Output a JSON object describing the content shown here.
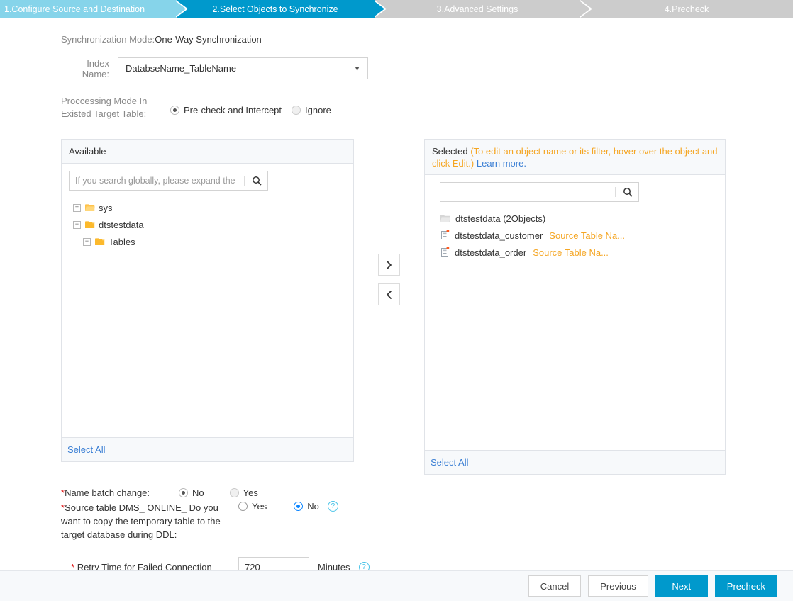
{
  "steps": [
    {
      "label": "1.Configure Source and Destination",
      "state": "done"
    },
    {
      "label": "2.Select Objects to Synchronize",
      "state": "active"
    },
    {
      "label": "3.Advanced Settings",
      "state": "todo"
    },
    {
      "label": "4.Precheck",
      "state": "todo"
    }
  ],
  "form": {
    "sync_mode_label": "Synchronization Mode:",
    "sync_mode_value": "One-Way Synchronization",
    "index_name_label": "Index Name:",
    "index_name_value": "DatabseName_TableName",
    "processing_mode_label_l1": "Proccessing Mode In",
    "processing_mode_label_l2": "Existed Target Table:",
    "processing_mode_opt1": "Pre-check and Intercept",
    "processing_mode_opt2": "Ignore"
  },
  "available": {
    "title": "Available",
    "search_placeholder": "If you search globally, please expand the n",
    "search_value": "",
    "select_all": "Select All",
    "tree": [
      {
        "label": "sys",
        "level": 1,
        "toggle": "+",
        "folder": "folder-closed-icon"
      },
      {
        "label": "dtstestdata",
        "level": 1,
        "toggle": "−",
        "folder": "folder-open-icon"
      },
      {
        "label": "Tables",
        "level": 2,
        "toggle": "−",
        "folder": "folder-open-icon"
      }
    ]
  },
  "selected": {
    "title": "Selected",
    "hint": "(To edit an object name or its filter, hover over the object and click Edit.)",
    "learn_more": "Learn more.",
    "search_placeholder": "",
    "search_value": "",
    "select_all": "Select All",
    "items": [
      {
        "icon": "folder-icon",
        "name": "dtstestdata (2Objects)",
        "sub": ""
      },
      {
        "icon": "table-icon",
        "name": "dtstestdata_customer",
        "sub": "Source Table Na..."
      },
      {
        "icon": "table-icon",
        "name": "dtstestdata_order",
        "sub": "Source Table Na..."
      }
    ]
  },
  "transfer": {
    "to_right": "›",
    "to_left": "‹"
  },
  "lower": {
    "batch_change_label": "Name batch change:",
    "batch_no": "No",
    "batch_yes": "Yes",
    "dms_label": "Source table DMS_ ONLINE_ Do you want to copy the temporary table to the target database during DDL:",
    "dms_yes": "Yes",
    "dms_no": "No",
    "retry_label": "Retry Time for Failed Connection",
    "retry_value": "720",
    "retry_unit": "Minutes",
    "help_glyph": "?"
  },
  "footer": {
    "cancel": "Cancel",
    "previous": "Previous",
    "next": "Next",
    "precheck": "Precheck"
  },
  "colors": {
    "accent": "#0099cc",
    "step_done": "#86d4ea",
    "step_todo": "#cccccc",
    "hint_orange": "#f5a623",
    "link_blue": "#3b7fd4",
    "required_red": "#e02020",
    "help_cyan": "#47c3e8"
  }
}
